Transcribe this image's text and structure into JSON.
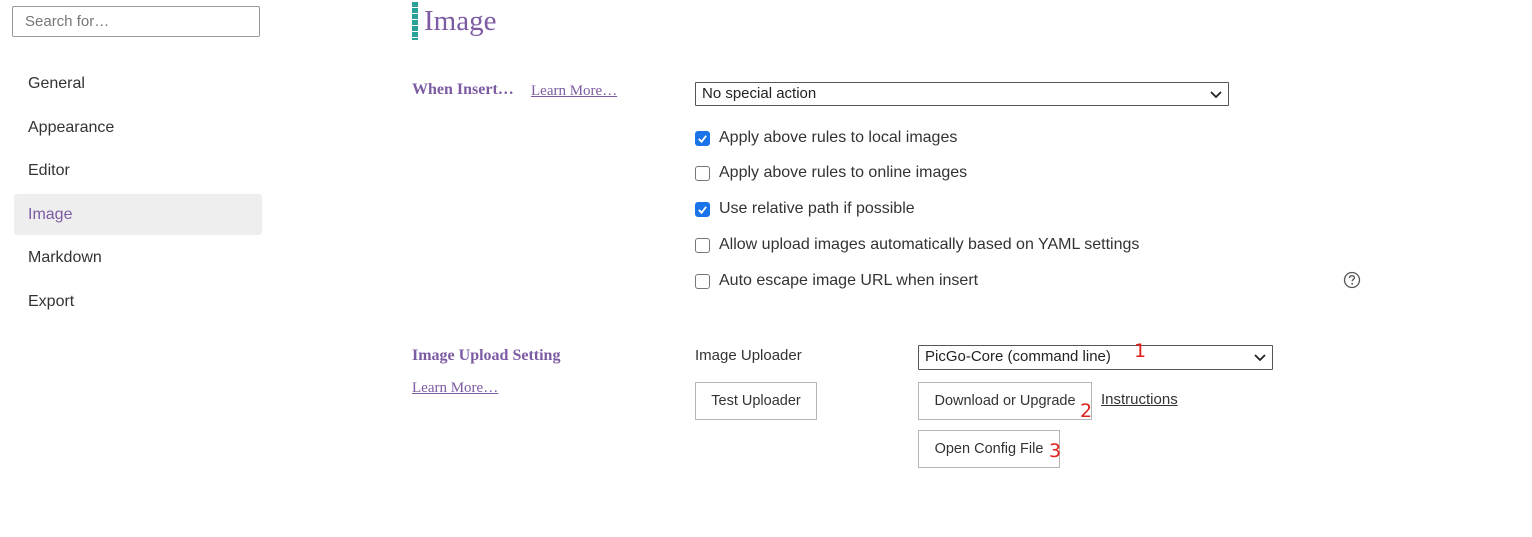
{
  "search": {
    "placeholder": "Search for…"
  },
  "sidebar": {
    "items": [
      {
        "label": "General"
      },
      {
        "label": "Appearance"
      },
      {
        "label": "Editor"
      },
      {
        "label": "Image"
      },
      {
        "label": "Markdown"
      },
      {
        "label": "Export"
      }
    ],
    "active_index": 3
  },
  "page": {
    "title": "Image"
  },
  "when_insert": {
    "label": "When Insert…",
    "learn_more": "Learn More…",
    "selected_action": "No special action",
    "options": [
      {
        "label": "Apply above rules to local images",
        "checked": true
      },
      {
        "label": "Apply above rules to online images",
        "checked": false
      },
      {
        "label": "Use relative path if possible",
        "checked": true
      },
      {
        "label": "Allow upload images automatically based on YAML settings",
        "checked": false
      },
      {
        "label": "Auto escape image URL when insert",
        "checked": false
      }
    ],
    "help_icon": "question-circle-icon"
  },
  "upload": {
    "label": "Image Upload Setting",
    "learn_more": "Learn More…",
    "uploader_label": "Image Uploader",
    "uploader_value": "PicGo-Core (command line)",
    "test_button": "Test Uploader",
    "download_button": "Download or Upgrade",
    "instructions_link": "Instructions",
    "config_button": "Open Config File"
  },
  "annotations": {
    "a1": "1",
    "a2": "2",
    "a3": "3"
  },
  "colors": {
    "accent_purple": "#7c5ba3",
    "title_bar_teal": "#2aa198",
    "checkbox_blue": "#1a73e8",
    "annotation_red": "#e0201a",
    "active_bg": "#eeeeee"
  }
}
